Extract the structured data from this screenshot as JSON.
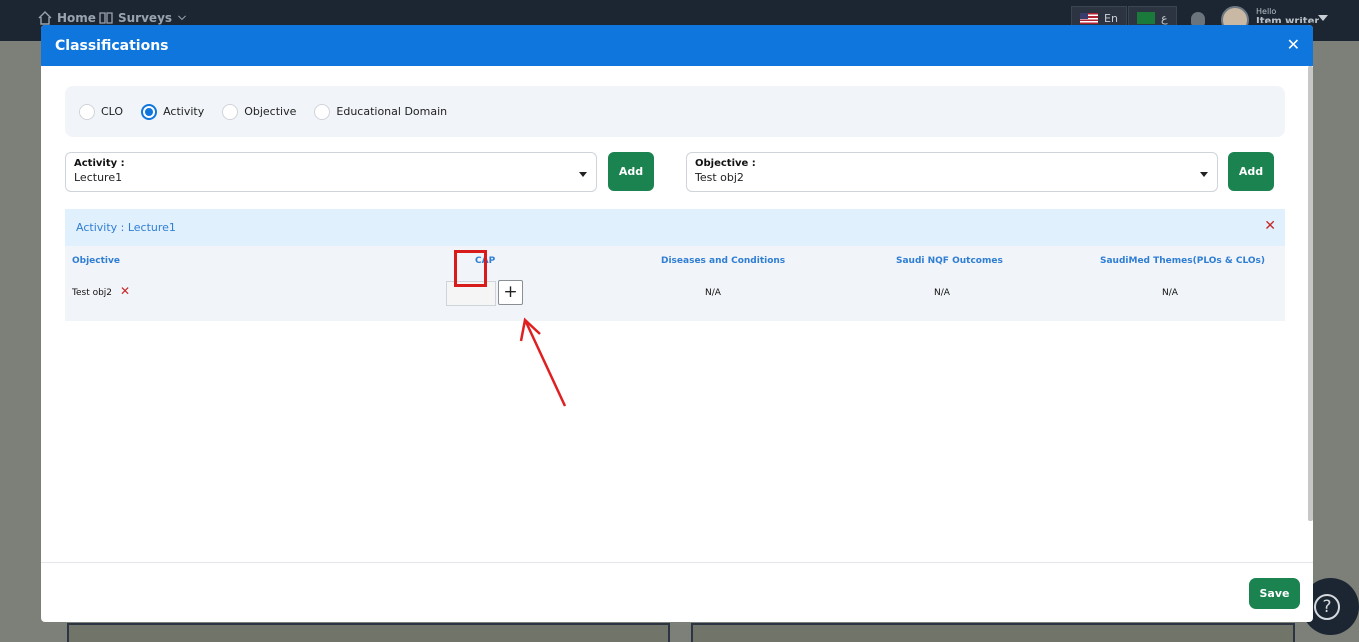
{
  "background": {
    "nav": {
      "home": "Home",
      "surveys": "Surveys"
    },
    "lang_en": "En",
    "lang_ar": "ع",
    "hello": "Hello",
    "user_name": "Item writer"
  },
  "modal": {
    "title": "Classifications",
    "close_glyph": "✕",
    "radio_options": [
      {
        "label": "CLO",
        "checked": false
      },
      {
        "label": "Activity",
        "checked": true
      },
      {
        "label": "Objective",
        "checked": false
      },
      {
        "label": "Educational Domain",
        "checked": false
      }
    ],
    "activity_select": {
      "label": "Activity :",
      "value": "Lecture1"
    },
    "objective_select": {
      "label": "Objective :",
      "value": "Test obj2"
    },
    "add_label": "Add",
    "group": {
      "title": "Activity : Lecture1",
      "remove_glyph": "✕",
      "columns": [
        "Objective",
        "CAP",
        "Diseases and Conditions",
        "Saudi NQF Outcomes",
        "SaudiMed Themes(PLOs & CLOs)"
      ],
      "row": {
        "objective": "Test obj2",
        "remove_glyph": "✕",
        "cap_add_glyph": "+",
        "diseases": "N/A",
        "nqf": "N/A",
        "saudimed": "N/A"
      }
    },
    "save_label": "Save"
  },
  "help_glyph": "?",
  "colors": {
    "primary_blue": "#0f76de",
    "success_green": "#1b8350",
    "danger_red": "#c62828",
    "annotation_red": "#d81b1b"
  }
}
